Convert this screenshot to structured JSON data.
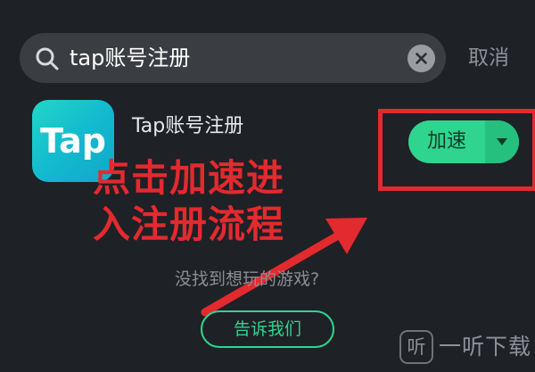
{
  "search": {
    "value": "tap账号注册",
    "clear_icon": "close-icon",
    "search_icon": "search-icon"
  },
  "header": {
    "cancel_label": "取消"
  },
  "app": {
    "icon_text": "Tap",
    "name": "Tap账号注册",
    "action_label": "加速",
    "action_dropdown_icon": "caret-down-icon"
  },
  "annotation": {
    "line1": "点击加速进",
    "line2": "入注册流程"
  },
  "not_found": {
    "text": "没找到想玩的游戏?",
    "button_label": "告诉我们"
  },
  "watermark": {
    "logo": "听",
    "text": "一听下载"
  },
  "colors": {
    "background": "#1e2126",
    "accent_green": "#2fd58e",
    "annotation_red": "#e22a2f",
    "search_bg": "#3a3d42"
  }
}
